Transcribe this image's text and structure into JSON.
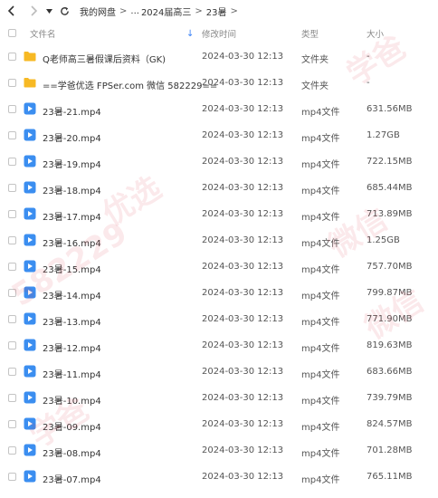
{
  "breadcrumb": {
    "items": [
      "我的网盘",
      "...",
      "2024届高三",
      "23暑"
    ]
  },
  "columns": {
    "name": "文件名",
    "date": "修改时间",
    "type": "类型",
    "size": "大小"
  },
  "files": [
    {
      "name": "Q老师高三暑假课后资料（GK)",
      "date": "2024-03-30 12:13",
      "type": "文件夹",
      "size": "-",
      "kind": "folder"
    },
    {
      "name": "==学爸优选 FPSer.com 微信 582229==",
      "date": "2024-03-30 12:13",
      "type": "文件夹",
      "size": "-",
      "kind": "folder"
    },
    {
      "name": "23暑-21.mp4",
      "date": "2024-03-30 12:13",
      "type": "mp4文件",
      "size": "631.56MB",
      "kind": "video"
    },
    {
      "name": "23暑-20.mp4",
      "date": "2024-03-30 12:13",
      "type": "mp4文件",
      "size": "1.27GB",
      "kind": "video"
    },
    {
      "name": "23暑-19.mp4",
      "date": "2024-03-30 12:13",
      "type": "mp4文件",
      "size": "722.15MB",
      "kind": "video"
    },
    {
      "name": "23暑-18.mp4",
      "date": "2024-03-30 12:13",
      "type": "mp4文件",
      "size": "685.44MB",
      "kind": "video"
    },
    {
      "name": "23暑-17.mp4",
      "date": "2024-03-30 12:13",
      "type": "mp4文件",
      "size": "713.89MB",
      "kind": "video"
    },
    {
      "name": "23暑-16.mp4",
      "date": "2024-03-30 12:13",
      "type": "mp4文件",
      "size": "1.25GB",
      "kind": "video"
    },
    {
      "name": "23暑-15.mp4",
      "date": "2024-03-30 12:13",
      "type": "mp4文件",
      "size": "757.70MB",
      "kind": "video"
    },
    {
      "name": "23暑-14.mp4",
      "date": "2024-03-30 12:13",
      "type": "mp4文件",
      "size": "799.87MB",
      "kind": "video"
    },
    {
      "name": "23暑-13.mp4",
      "date": "2024-03-30 12:13",
      "type": "mp4文件",
      "size": "771.90MB",
      "kind": "video"
    },
    {
      "name": "23暑-12.mp4",
      "date": "2024-03-30 12:13",
      "type": "mp4文件",
      "size": "819.63MB",
      "kind": "video"
    },
    {
      "name": "23暑-11.mp4",
      "date": "2024-03-30 12:13",
      "type": "mp4文件",
      "size": "683.66MB",
      "kind": "video"
    },
    {
      "name": "23暑-10.mp4",
      "date": "2024-03-30 12:13",
      "type": "mp4文件",
      "size": "739.79MB",
      "kind": "video"
    },
    {
      "name": "23暑-09.mp4",
      "date": "2024-03-30 12:13",
      "type": "mp4文件",
      "size": "824.57MB",
      "kind": "video"
    },
    {
      "name": "23暑-08.mp4",
      "date": "2024-03-30 12:13",
      "type": "mp4文件",
      "size": "701.28MB",
      "kind": "video"
    },
    {
      "name": "23暑-07.mp4",
      "date": "2024-03-30 12:13",
      "type": "mp4文件",
      "size": "765.11MB",
      "kind": "video"
    }
  ],
  "watermarks": [
    "582229",
    "学爸",
    "微信",
    "优选",
    "微信",
    "学爸"
  ],
  "colors": {
    "folder": "#f7b924",
    "video": "#3b8ef0",
    "accent": "#3b82f6"
  }
}
